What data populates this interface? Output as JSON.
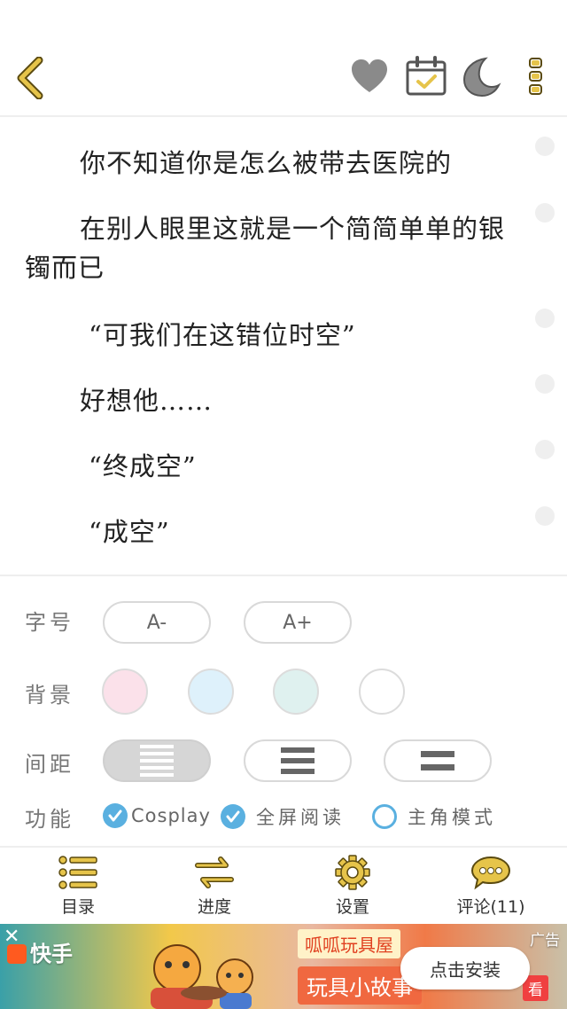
{
  "header": {
    "back_icon": "chevron-left-icon",
    "actions": [
      "heart-icon",
      "calendar-check-icon",
      "moon-icon",
      "more-vertical-icon"
    ],
    "accent_color": "#e6c44a"
  },
  "reader": {
    "paragraphs": [
      {
        "text": "你不知道你是怎么被带去医院的"
      },
      {
        "text": "在别人眼里这就是一个简简单单的银镯而已"
      },
      {
        "text": "“可我们在这错位时空”"
      },
      {
        "text": "好想他……"
      },
      {
        "text": "“终成空”"
      },
      {
        "text": "“成空”"
      }
    ]
  },
  "settings": {
    "font_size": {
      "label": "字号",
      "decrease": "A-",
      "increase": "A+"
    },
    "background": {
      "label": "背景",
      "colors": [
        "#fbe1ea",
        "#def1fb",
        "#dff1ef",
        "#ffffff"
      ]
    },
    "spacing": {
      "label": "间距",
      "selected": 0
    },
    "features": {
      "label": "功能",
      "cosplay": "Cosplay",
      "fullscreen": "全屏阅读",
      "protagonist": "主角模式",
      "cosplay_checked": true,
      "fullscreen_checked": true,
      "protagonist_checked": false
    }
  },
  "nav": {
    "catalog": "目录",
    "progress": "进度",
    "settings": "设置",
    "comments": "评论(11)"
  },
  "ad": {
    "brand": "快手",
    "store": "呱呱玩具屋",
    "story": "玩具小故事",
    "tag": "广告",
    "install": "点击安装",
    "watch": "看"
  }
}
